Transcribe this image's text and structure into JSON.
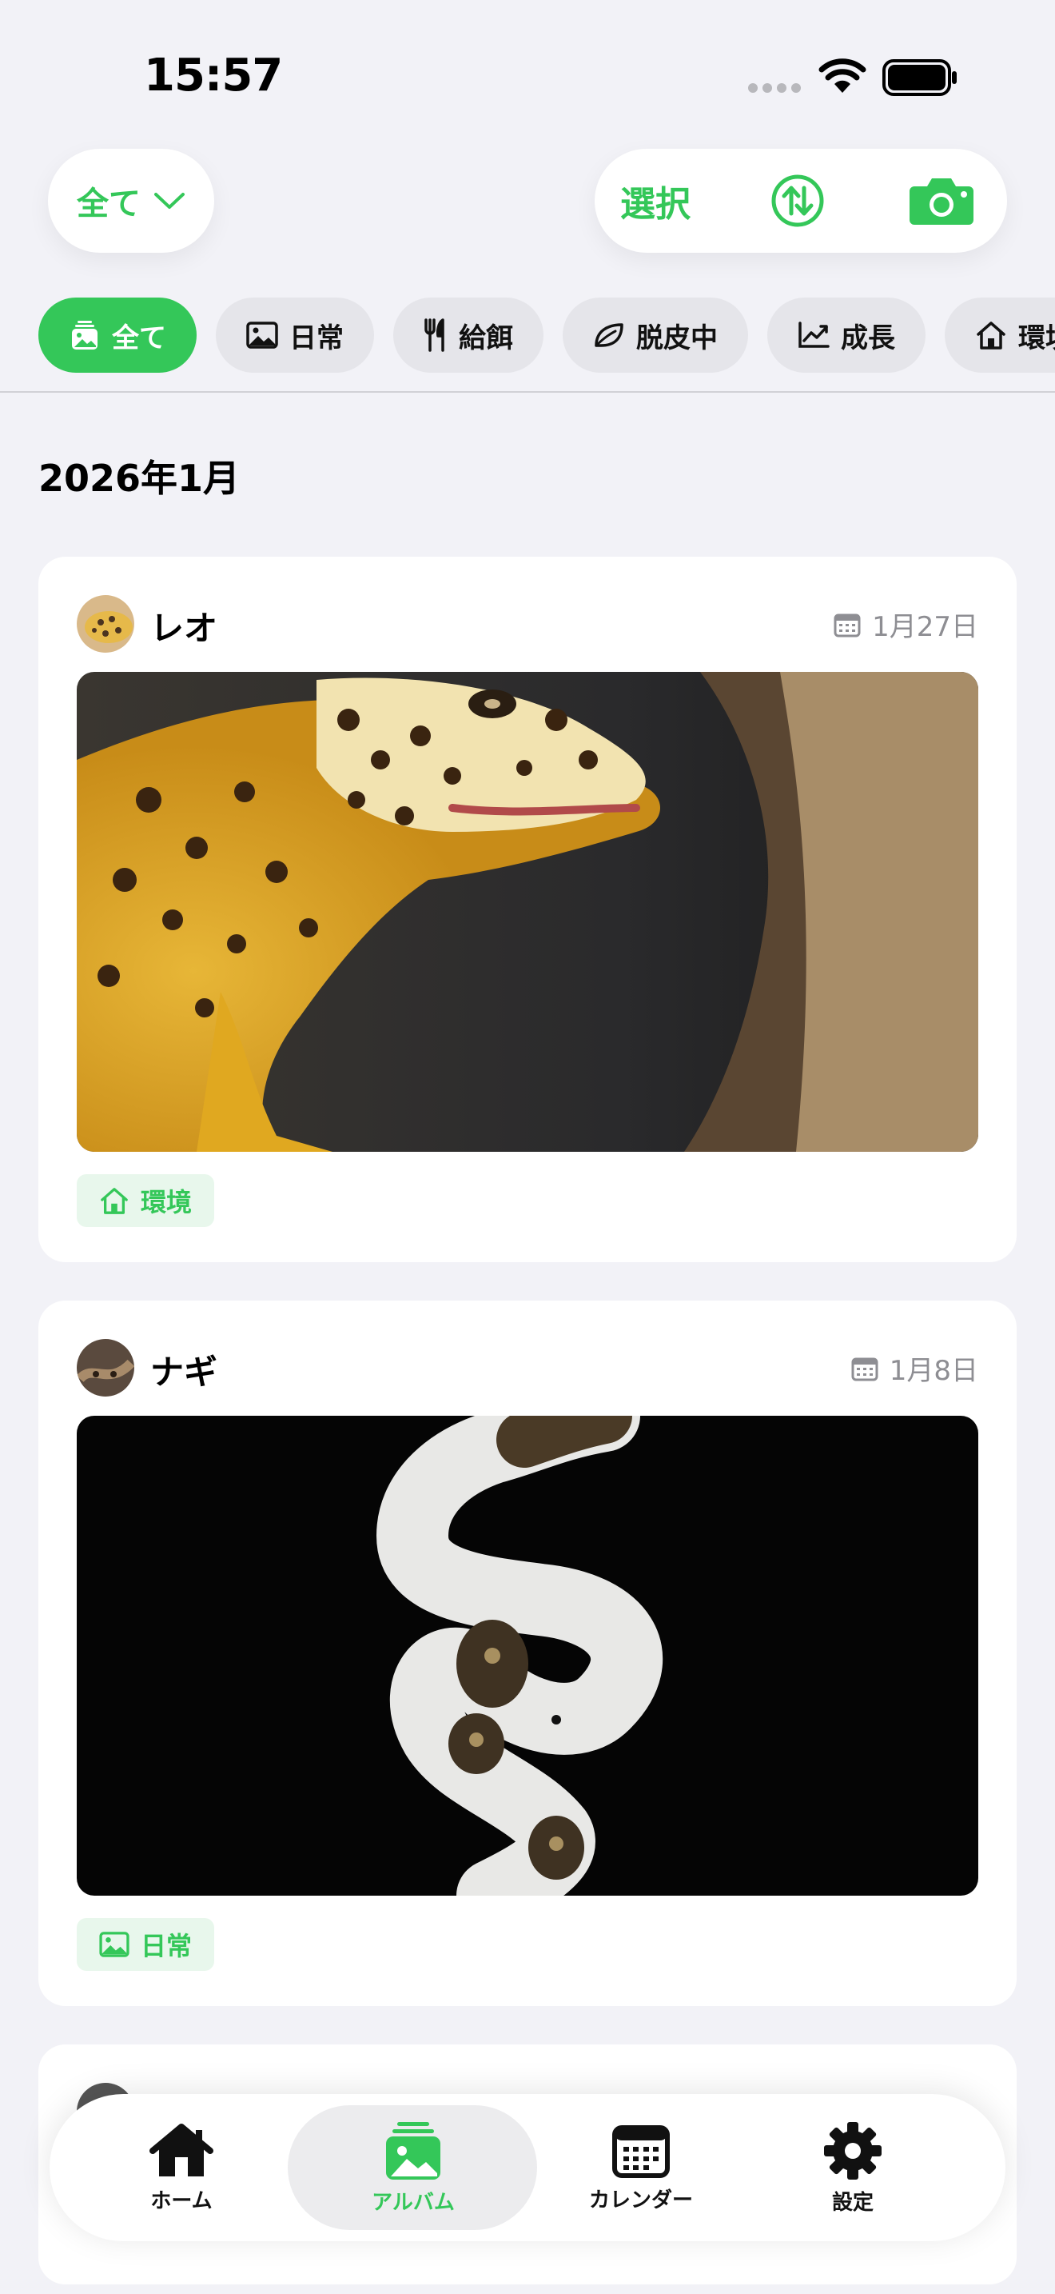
{
  "status_bar": {
    "time": "15:57"
  },
  "header": {
    "filter_dropdown_label": "全て",
    "select_label": "選択"
  },
  "categories": [
    {
      "label": "全て",
      "icon": "album-stack-icon",
      "active": true
    },
    {
      "label": "日常",
      "icon": "photo-icon"
    },
    {
      "label": "給餌",
      "icon": "fork-knife-icon"
    },
    {
      "label": "脱皮中",
      "icon": "leaf-icon"
    },
    {
      "label": "成長",
      "icon": "chart-line-icon"
    },
    {
      "label": "環境",
      "icon": "house-icon"
    }
  ],
  "section": {
    "month": "2026年1月"
  },
  "entries": [
    {
      "pet_name": "レオ",
      "date": "1月27日",
      "tag": "環境",
      "tag_icon": "house-icon",
      "photo": "leopard gecko"
    },
    {
      "pet_name": "ナギ",
      "date": "1月8日",
      "tag": "日常",
      "tag_icon": "photo-icon",
      "photo": "ball python"
    }
  ],
  "tabbar": {
    "items": [
      {
        "label": "ホーム",
        "icon": "house-icon"
      },
      {
        "label": "アルバム",
        "icon": "album-stack-icon",
        "active": true
      },
      {
        "label": "カレンダー",
        "icon": "calendar-icon"
      },
      {
        "label": "設定",
        "icon": "gear-icon"
      }
    ]
  },
  "colors": {
    "accent": "#34c759",
    "background": "#f2f2f7",
    "chip": "#e5e5ea"
  }
}
